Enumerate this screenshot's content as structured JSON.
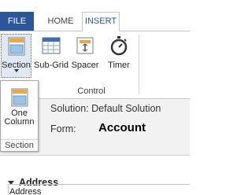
{
  "tabs": {
    "file": "FILE",
    "home": "HOME",
    "insert": "INSERT"
  },
  "ribbon": {
    "section_label": "Section",
    "subgrid_label": "Sub-Grid",
    "spacer_label": "Spacer",
    "timer_label": "Timer",
    "group_label": "Control"
  },
  "flyout": {
    "one_column_line1": "One",
    "one_column_line2": "Column",
    "group_label": "Section"
  },
  "header": {
    "solution_label": "Solution: Default Solution",
    "form_label": "Form:",
    "form_name": "Account"
  },
  "body": {
    "section_title": "Address",
    "section_field": "Address"
  },
  "colors": {
    "file_tab": "#2b579a",
    "accent_blue": "#2b579a",
    "selected_bg": "#dfe8f3"
  }
}
